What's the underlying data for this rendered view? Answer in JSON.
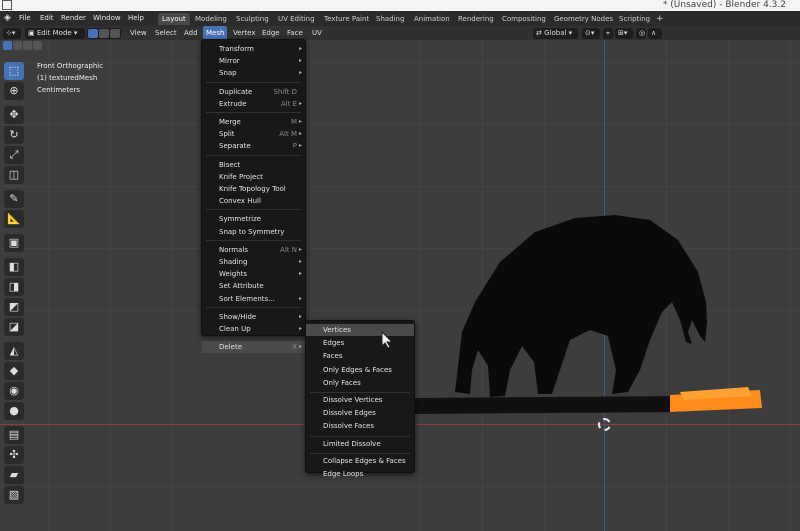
{
  "window": {
    "title": "* (Unsaved) - Blender 4.3.2"
  },
  "topbar": {
    "menus": [
      "File",
      "Edit",
      "Render",
      "Window",
      "Help"
    ],
    "workspaces": [
      "Layout",
      "Modeling",
      "Sculpting",
      "UV Editing",
      "Texture Paint",
      "Shading",
      "Animation",
      "Rendering",
      "Compositing",
      "Geometry Nodes",
      "Scripting"
    ],
    "add_tab": "+"
  },
  "header": {
    "mode": "Edit Mode",
    "menus": [
      "View",
      "Select",
      "Add",
      "Mesh",
      "Vertex",
      "Edge",
      "Face",
      "UV"
    ],
    "orientation": "Global"
  },
  "overlay": {
    "view": "Front Orthographic",
    "object": "(1) texturedMesh",
    "units": "Centimeters"
  },
  "mesh_menu": [
    {
      "label": "Transform",
      "arrow": true
    },
    {
      "label": "Mirror",
      "arrow": true
    },
    {
      "label": "Snap",
      "arrow": true
    },
    {
      "sep": true
    },
    {
      "label": "Duplicate",
      "shortcut": "Shift D"
    },
    {
      "label": "Extrude",
      "shortcut": "Alt E",
      "arrow": true
    },
    {
      "sep": true
    },
    {
      "label": "Merge",
      "shortcut": "M",
      "arrow": true
    },
    {
      "label": "Split",
      "shortcut": "Alt M",
      "arrow": true
    },
    {
      "label": "Separate",
      "shortcut": "P",
      "arrow": true
    },
    {
      "sep": true
    },
    {
      "label": "Bisect"
    },
    {
      "label": "Knife Project"
    },
    {
      "label": "Knife Topology Tool"
    },
    {
      "label": "Convex Hull"
    },
    {
      "sep": true
    },
    {
      "label": "Symmetrize"
    },
    {
      "label": "Snap to Symmetry"
    },
    {
      "sep": true
    },
    {
      "label": "Normals",
      "shortcut": "Alt N",
      "arrow": true
    },
    {
      "label": "Shading",
      "arrow": true
    },
    {
      "label": "Weights",
      "arrow": true
    },
    {
      "label": "Set Attribute"
    },
    {
      "label": "Sort Elements...",
      "arrow": true
    },
    {
      "sep": true
    },
    {
      "label": "Show/Hide",
      "arrow": true
    },
    {
      "label": "Clean Up",
      "arrow": true
    },
    {
      "sep": true
    },
    {
      "label": "Delete",
      "shortcut": "X",
      "arrow": true,
      "highlight": true
    }
  ],
  "delete_menu": [
    {
      "label": "Vertices",
      "highlight": true
    },
    {
      "label": "Edges"
    },
    {
      "label": "Faces"
    },
    {
      "label": "Only Edges & Faces"
    },
    {
      "label": "Only Faces"
    },
    {
      "sep": true
    },
    {
      "label": "Dissolve Vertices"
    },
    {
      "label": "Dissolve Edges"
    },
    {
      "label": "Dissolve Faces"
    },
    {
      "sep": true
    },
    {
      "label": "Limited Dissolve"
    },
    {
      "sep": true
    },
    {
      "label": "Collapse Edges & Faces"
    },
    {
      "label": "Edge Loops"
    }
  ],
  "colors": {
    "accent": "#4772b3",
    "orange": "#ff8c1a",
    "red_axis": "#8c3a44",
    "blue_axis": "#3a5a8c"
  }
}
